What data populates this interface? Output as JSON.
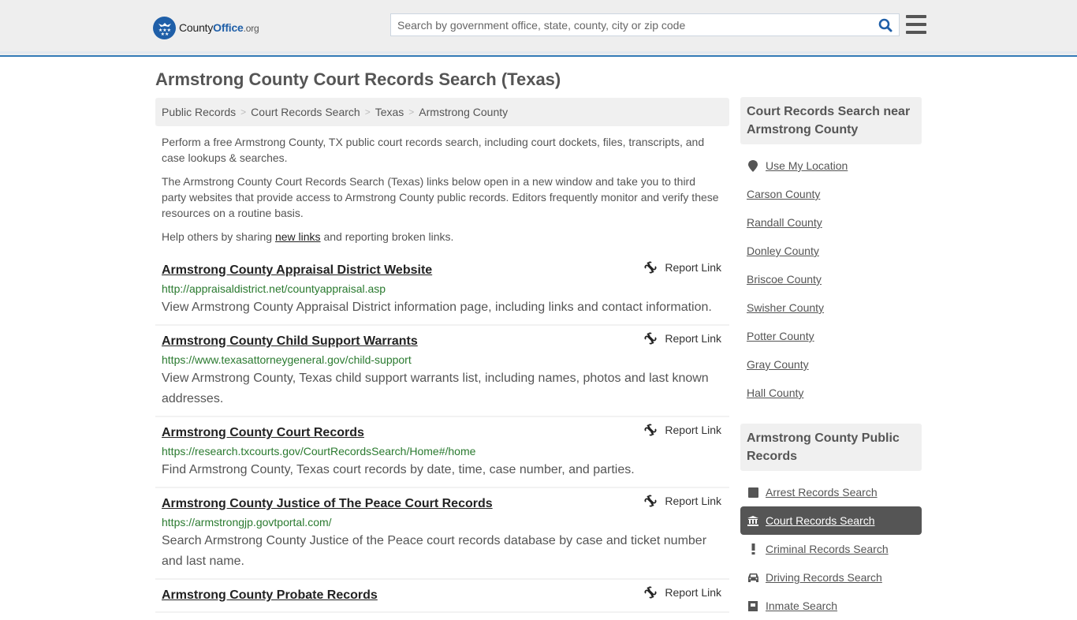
{
  "header": {
    "logo": {
      "brand_prefix": "County",
      "brand_main": "Office",
      "brand_tld": ".org"
    },
    "search": {
      "placeholder": "Search by government office, state, county, city or zip code",
      "value": "",
      "icon": "search-icon"
    },
    "menu_icon": "hamburger-menu-icon"
  },
  "page": {
    "title": "Armstrong County Court Records Search (Texas)",
    "breadcrumb": [
      "Public Records",
      "Court Records Search",
      "Texas",
      "Armstrong County"
    ],
    "breadcrumb_separator": ">",
    "intro": {
      "p1": "Perform a free Armstrong County, TX public court records search, including court dockets, files, transcripts, and case lookups & searches.",
      "p2": "The Armstrong County Court Records Search (Texas) links below open in a new window and take you to third party websites that provide access to Armstrong County public records. Editors frequently monitor and verify these resources on a routine basis.",
      "p3_before": "Help others by sharing ",
      "p3_link": "new links",
      "p3_after": " and reporting broken links."
    }
  },
  "results": [
    {
      "title": "Armstrong County Appraisal District Website",
      "url": "http://appraisaldistrict.net/countyappraisal.asp",
      "description": "View Armstrong County Appraisal District information page, including links and contact information.",
      "report_label": "Report Link"
    },
    {
      "title": "Armstrong County Child Support Warrants",
      "url": "https://www.texasattorneygeneral.gov/child-support",
      "description": "View Armstrong County, Texas child support warrants list, including names, photos and last known addresses.",
      "report_label": "Report Link"
    },
    {
      "title": "Armstrong County Court Records",
      "url": "https://research.txcourts.gov/CourtRecordsSearch/Home#/home",
      "description": "Find Armstrong County, Texas court records by date, time, case number, and parties.",
      "report_label": "Report Link"
    },
    {
      "title": "Armstrong County Justice of The Peace Court Records",
      "url": "https://armstrongjp.govtportal.com/",
      "description": "Search Armstrong County Justice of the Peace court records database by case and ticket number and last name.",
      "report_label": "Report Link"
    },
    {
      "title": "Armstrong County Probate Records",
      "url": "",
      "description": "",
      "report_label": "Report Link"
    }
  ],
  "sidebar": {
    "nearby": {
      "heading": "Court Records Search near Armstrong County",
      "use_location": "Use My Location",
      "counties": [
        "Carson County",
        "Randall County",
        "Donley County",
        "Briscoe County",
        "Swisher County",
        "Potter County",
        "Gray County",
        "Hall County"
      ]
    },
    "public_records": {
      "heading": "Armstrong County Public Records",
      "items": [
        {
          "label": "Arrest Records Search",
          "icon": "square-icon",
          "active": false
        },
        {
          "label": "Court Records Search",
          "icon": "courthouse-icon",
          "active": true
        },
        {
          "label": "Criminal Records Search",
          "icon": "exclamation-icon",
          "active": false
        },
        {
          "label": "Driving Records Search",
          "icon": "car-icon",
          "active": false
        },
        {
          "label": "Inmate Search",
          "icon": "inmate-icon",
          "active": false
        }
      ]
    }
  },
  "colors": {
    "accent_blue": "#337ab7",
    "logo_blue": "#1f5fa8",
    "url_green": "#2a7a2f",
    "active_item_bg": "#555555",
    "panel_bg": "#f0f0f0"
  }
}
